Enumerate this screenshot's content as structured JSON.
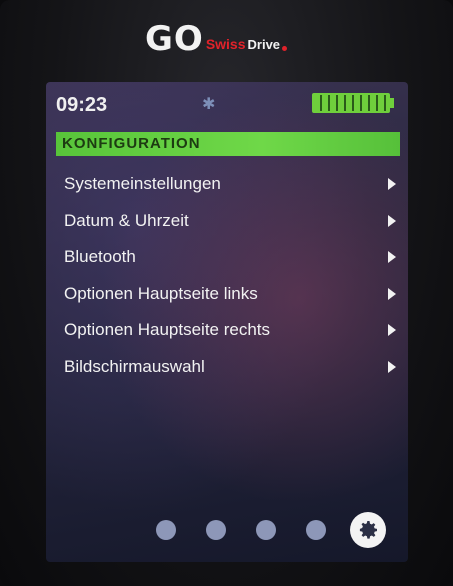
{
  "device": {
    "brand_go": "GO",
    "brand_swiss": "Swiss",
    "brand_drive": "Drive"
  },
  "status_bar": {
    "time": "09:23",
    "bluetooth_icon": "bluetooth-icon",
    "battery_level": 1.0
  },
  "screen": {
    "title": "KONFIGURATION"
  },
  "menu": {
    "items": [
      {
        "label": "Systemeinstellungen"
      },
      {
        "label": "Datum & Uhrzeit"
      },
      {
        "label": "Bluetooth"
      },
      {
        "label": "Optionen Hauptseite links"
      },
      {
        "label": "Optionen Hauptseite rechts"
      },
      {
        "label": "Bildschirmauswahl"
      }
    ]
  },
  "pager": {
    "pages": 5,
    "active_icon": "gear-icon"
  },
  "colors": {
    "accent": "#6fd848",
    "brand_red": "#e0222a"
  }
}
